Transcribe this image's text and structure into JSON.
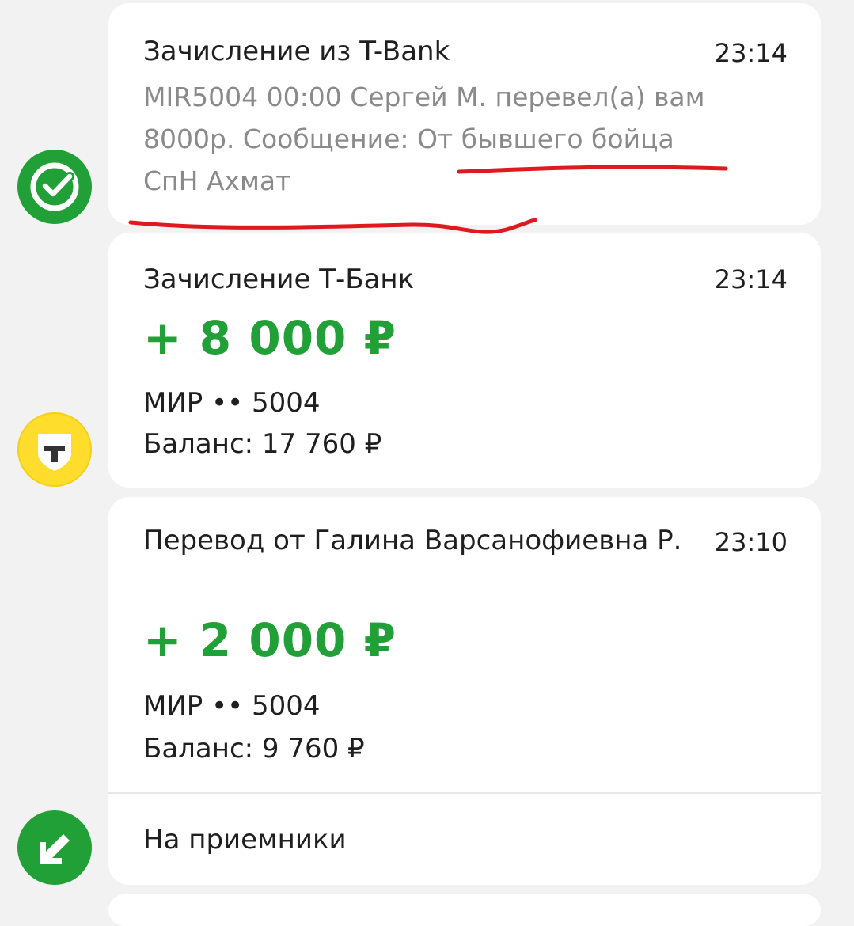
{
  "transactions": [
    {
      "title": "Зачисление из T-Bank",
      "time": "23:14",
      "message": "MIR5004 00:00 Сергей М. перевел(а) вам 8000р. Сообщение: От бывшего бойца СпН Ахмат",
      "icon": "sber-check-icon"
    },
    {
      "title": "Зачисление Т-Банк",
      "time": "23:14",
      "amount": "+ 8 000 ₽",
      "card": "МИР •• 5004",
      "balance": "Баланс: 17 760 ₽",
      "icon": "tbank-shield-icon"
    },
    {
      "title": "Перевод от Галина Варсанофиевна Р.",
      "time": "23:10",
      "amount": "+ 2 000 ₽",
      "card": "МИР •• 5004",
      "balance": "Баланс: 9 760 ₽",
      "note": "На приемники",
      "icon": "incoming-arrow-icon"
    }
  ],
  "colors": {
    "background": "#f2f2f2",
    "card": "#ffffff",
    "accent_green": "#21a038",
    "tbank_yellow": "#ffdd2d",
    "muted_text": "#8a8a8a",
    "annotation_red": "#e0191f"
  }
}
